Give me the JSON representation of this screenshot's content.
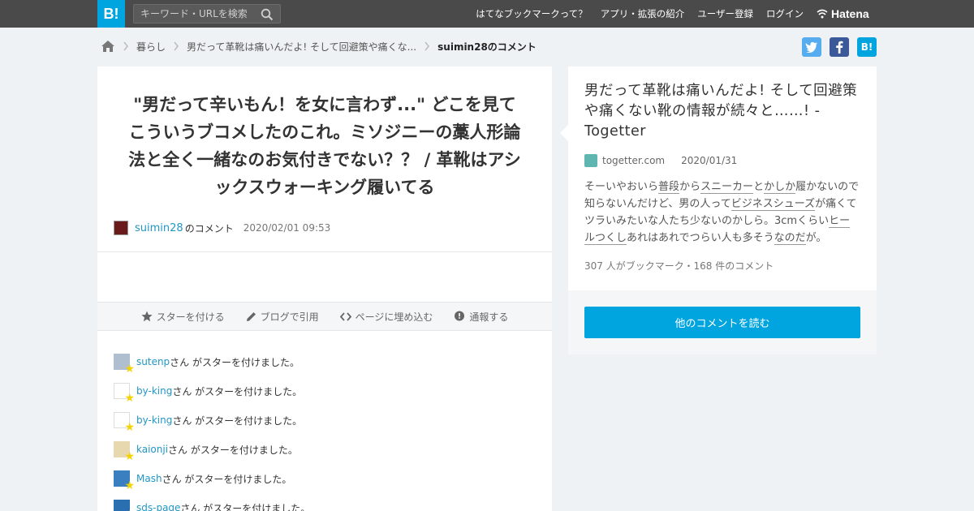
{
  "header": {
    "logo": "B!",
    "search_placeholder": "キーワード・URLを検索",
    "nav": [
      "はてなブックマークって？",
      "アプリ・拡張の紹介",
      "ユーザー登録",
      "ログイン"
    ],
    "brand": "Hatena"
  },
  "breadcrumb": {
    "items": [
      "暮らし",
      "男だって革靴は痛いんだよ! そして回避策や痛くな..."
    ],
    "current": "suimin28のコメント"
  },
  "share": {
    "twitter": "t",
    "facebook": "f",
    "hatena": "B!"
  },
  "comment": {
    "text": "\"男だって辛いもん！を女に言わず...\" どこを見てこういうブコメしたのこれ。ミソジニーの藁人形論法と全く一緒なのお気付きでない？？ / 革靴はアシックスウォーキング履いてる",
    "author": "suimin28",
    "author_suffix": "のコメント",
    "time": "2020/02/01 09:53"
  },
  "actions": {
    "star": "スターを付ける",
    "blog": "ブログで引用",
    "embed": "ページに埋め込む",
    "report": "通報する"
  },
  "stars": [
    {
      "user": "sutenp",
      "text": "さん がスターを付けました。",
      "color": "#b0bfd0"
    },
    {
      "user": "by-king",
      "text": "さん がスターを付けました。",
      "color": "#ffffff"
    },
    {
      "user": "by-king",
      "text": "さん がスターを付けました。",
      "color": "#ffffff"
    },
    {
      "user": "kaionji",
      "text": "さん がスターを付けました。",
      "color": "#e8d8b0"
    },
    {
      "user": "Mash",
      "text": "さん がスターを付けました。",
      "color": "#3a7fc0"
    },
    {
      "user": "sds-page",
      "text": "さん がスターを付けました。",
      "color": "#2a6fb0"
    }
  ],
  "entry": {
    "title": "男だって革靴は痛いんだよ! そして回避策や痛くない靴の情報が続々と……! - Togetter",
    "site": "togetter.com",
    "date": "2020/01/31",
    "excerpt_parts": [
      {
        "t": "そーいやおいら",
        "kw": false
      },
      {
        "t": "普段",
        "kw": true
      },
      {
        "t": "から",
        "kw": false
      },
      {
        "t": "スニーカー",
        "kw": true
      },
      {
        "t": "と",
        "kw": false
      },
      {
        "t": "かしか",
        "kw": true
      },
      {
        "t": "履かないので知らないんだけど、男の人って",
        "kw": false
      },
      {
        "t": "ビジネスシューズ",
        "kw": true
      },
      {
        "t": "が痛くてツラいみたいな人たち少ないのかしら。3cmくらい",
        "kw": false
      },
      {
        "t": "ヒールつくし",
        "kw": true
      },
      {
        "t": "あれはあれでつらい人も多そう",
        "kw": false
      },
      {
        "t": "なのだ",
        "kw": true
      },
      {
        "t": "が。",
        "kw": false
      }
    ],
    "counts": "307 人がブックマーク・168 件のコメント",
    "more_button": "他のコメントを読む"
  }
}
